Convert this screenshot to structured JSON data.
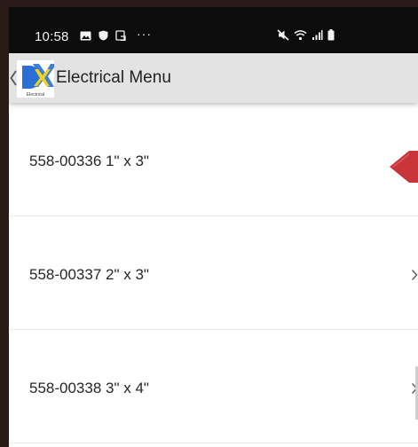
{
  "status_bar": {
    "time": "10:58",
    "left_icons": [
      "gallery-icon",
      "shield-icon",
      "screenshot-icon"
    ],
    "more_indicator": "···",
    "right_icons": [
      "mute-icon",
      "wifi-icon",
      "signal-icon",
      "battery-icon"
    ]
  },
  "app_bar": {
    "logo_text": "Electrical",
    "title": "Electrical Menu",
    "colors": {
      "background": "#e3e3e3",
      "logo_blue": "#2a6fd6",
      "logo_yellow": "#f2d21b"
    }
  },
  "menu": {
    "items": [
      {
        "label": "558-00336 1\" x 3\""
      },
      {
        "label": "558-00337 2\" x 3\""
      },
      {
        "label": "558-00338 3\" x 4\""
      }
    ]
  },
  "accent": {
    "marker_color": "#c8353a"
  }
}
